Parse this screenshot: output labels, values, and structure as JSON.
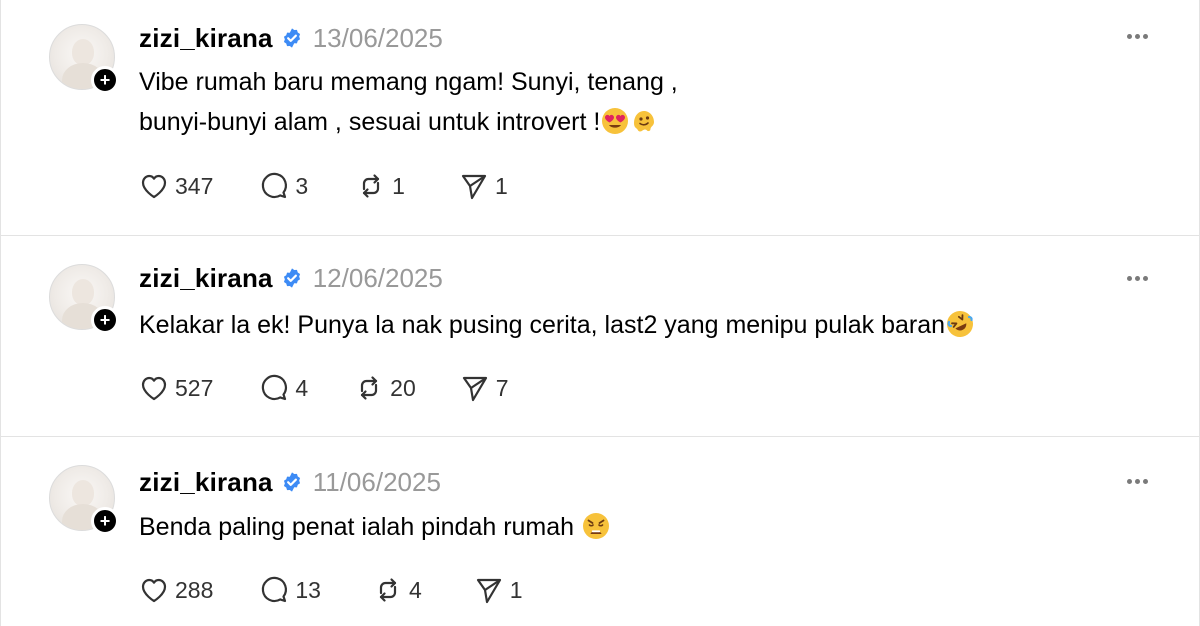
{
  "posts": [
    {
      "username": "zizi_kirana",
      "date": "13/06/2025",
      "text_lines": [
        "Vibe rumah baru memang ngam! Sunyi, tenang ,",
        "bunyi-bunyi alam , sesuai untuk introvert !"
      ],
      "emojis": [
        "heart-eyes-emoji",
        "melting-face-emoji"
      ],
      "likes": "347",
      "replies": "3",
      "reposts": "1",
      "shares": "1"
    },
    {
      "username": "zizi_kirana",
      "date": "12/06/2025",
      "text_lines": [
        "Kelakar la ek! Punya la nak pusing cerita, last2 yang menipu pulak baran"
      ],
      "emojis": [
        "rofl-emoji"
      ],
      "likes": "527",
      "replies": "4",
      "reposts": "20",
      "shares": "7"
    },
    {
      "username": "zizi_kirana",
      "date": "11/06/2025",
      "text_lines": [
        "Benda paling penat ialah pindah rumah "
      ],
      "emojis": [
        "weary-face-emoji"
      ],
      "likes": "288",
      "replies": "13",
      "reposts": "4",
      "shares": "1"
    }
  ],
  "colors": {
    "verified": "#3d8bf5",
    "date": "#999999",
    "divider": "#e3e3e3",
    "icon": "#333333"
  },
  "icons": {
    "follow": "plus-icon",
    "verified": "verified-badge-icon",
    "more": "more-icon",
    "like": "heart-icon",
    "reply": "comment-icon",
    "repost": "repost-icon",
    "share": "send-icon"
  }
}
